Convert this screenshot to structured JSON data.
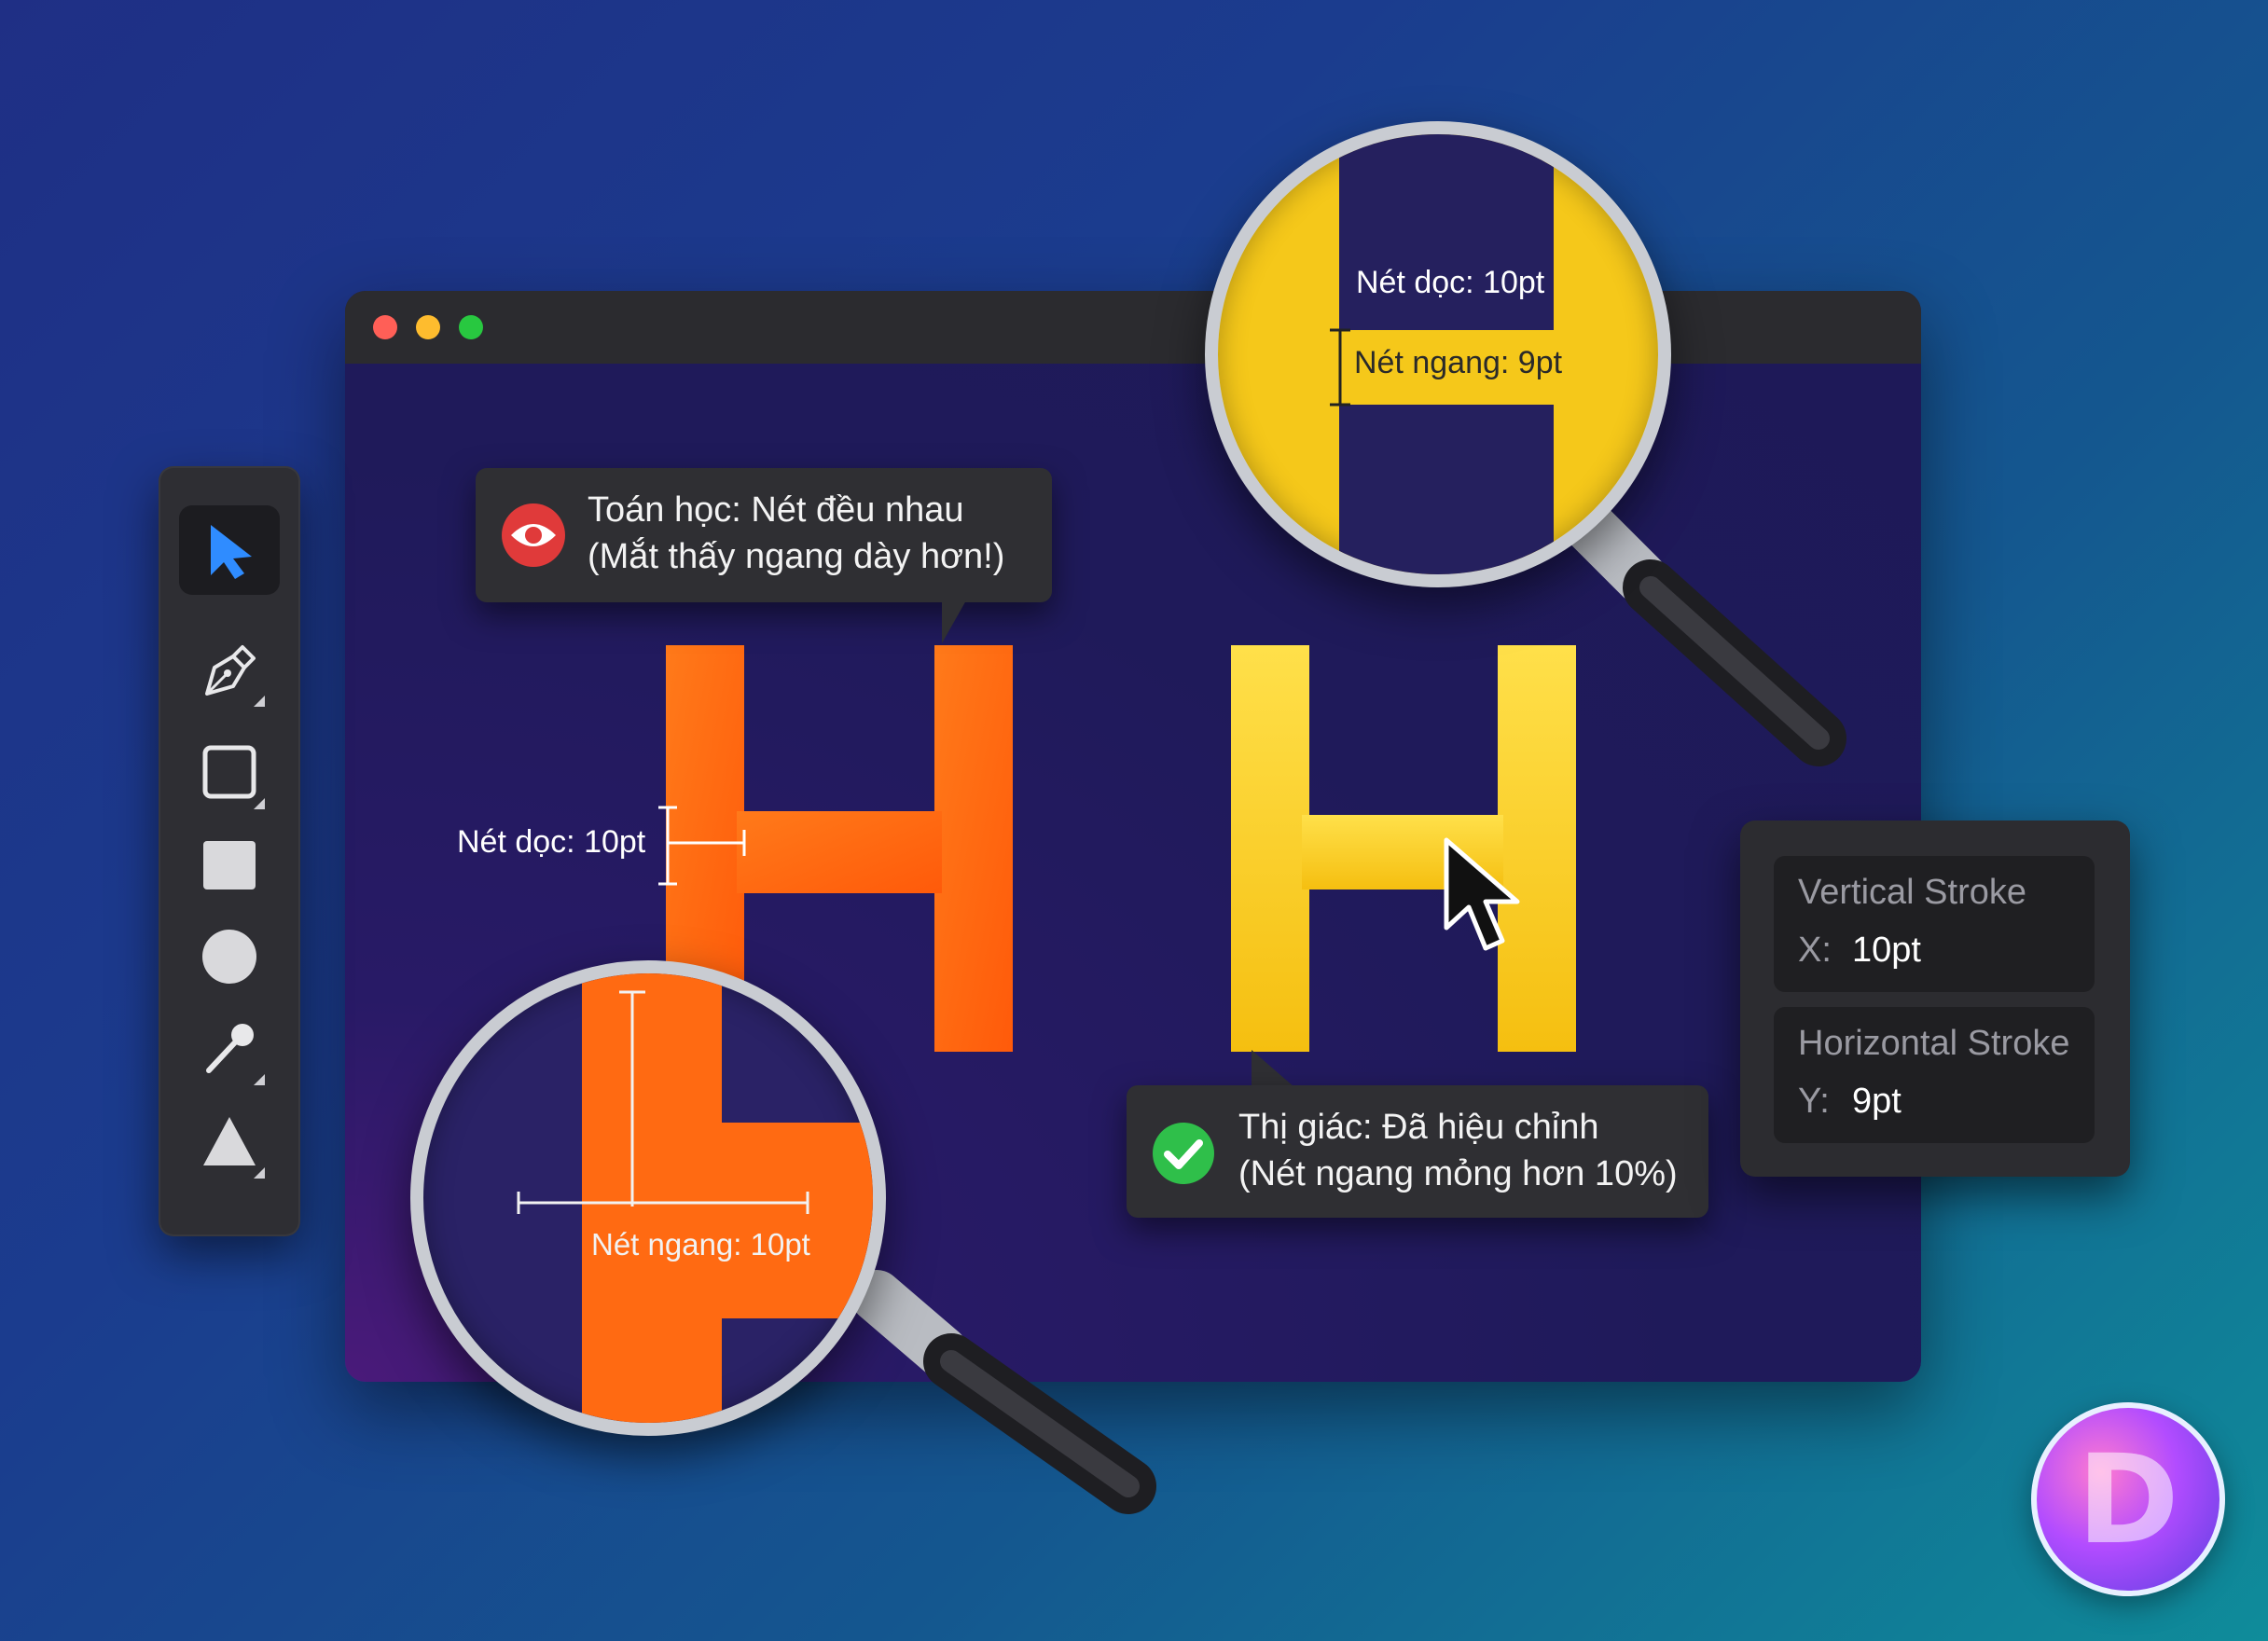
{
  "window": {
    "traffic_lights": {
      "close": "#ff5f57",
      "minimize": "#febc2e",
      "maximize": "#28c840"
    }
  },
  "toolbar": {
    "tools": [
      {
        "icon": "select-arrow-icon",
        "active": true
      },
      {
        "icon": "pen-tool-icon"
      },
      {
        "icon": "rectangle-outline-icon"
      },
      {
        "icon": "rectangle-fill-icon"
      },
      {
        "icon": "ellipse-icon"
      },
      {
        "icon": "eyedropper-icon"
      },
      {
        "icon": "triangle-icon"
      }
    ]
  },
  "glyphs": {
    "left": {
      "letter": "H",
      "color": "#ff6a12"
    },
    "right": {
      "letter": "H",
      "color": "#f7c61a"
    }
  },
  "tooltip_math": {
    "line1": "Toán học: Nét đều nhau",
    "line2": "(Mắt thấy ngang dày hơn!)",
    "icon": "eye-icon",
    "icon_color": "#e03a3a"
  },
  "tooltip_visual": {
    "line1": "Thị giác: Đã hiệu chỉnh",
    "line2": "(Nét ngang mỏng hơn 10%)",
    "icon": "checkmark-icon",
    "icon_color": "#2fbf4a"
  },
  "measurements": {
    "left_vertical": "Nét dọc: 10pt",
    "left_horizontal": "Nét ngang: 10pt",
    "right_vertical": "Nét dọc: 10pt",
    "right_horizontal": "Nét ngang: 9pt"
  },
  "properties": {
    "vertical": {
      "title": "Vertical Stroke",
      "axis": "X:",
      "value": "10pt"
    },
    "horizontal": {
      "title": "Horizontal Stroke",
      "axis": "Y:",
      "value": "9pt"
    }
  },
  "logo": {
    "letter": "D"
  }
}
